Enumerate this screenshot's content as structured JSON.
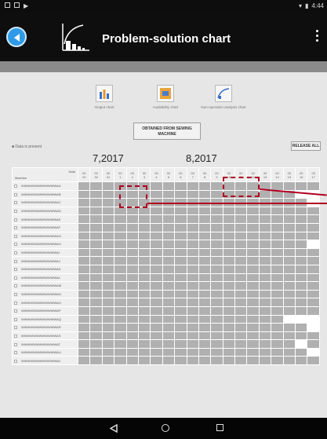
{
  "status_bar": {
    "time": "4:44"
  },
  "app_bar": {
    "title": "Problem-solution chart"
  },
  "chart_buttons": [
    {
      "label": "Output chart",
      "icon": "bar-chart-icon"
    },
    {
      "label": "Availability chart",
      "icon": "area-chart-icon"
    },
    {
      "label": "Non-operation analysis chart",
      "icon": "curve-chart-icon"
    }
  ],
  "obtained_button": "OBTAINED FROM SEWING MACHINE",
  "data_present_note": "■ Data is present",
  "release_all_button": "RELEASE ALL",
  "months": [
    "7,2017",
    "8,2017"
  ],
  "grid": {
    "header_date": "Date",
    "header_machine": "Machine",
    "days": [
      "29",
      "30",
      "31",
      "1",
      "2",
      "3",
      "4",
      "5",
      "6",
      "7",
      "8",
      "9",
      "10",
      "11",
      "12",
      "13",
      "14",
      "15",
      "16",
      "17"
    ],
    "day_prefix": "00",
    "machines": [
      "WWWWWWWWWWWWAA",
      "WWWWWWWWWWWWAB",
      "WWWWWWWWWWWWAC",
      "WWWWWWWWWWWWAD",
      "WWWWWWWWWWWWAE",
      "WWWWWWWWWWWWAF",
      "WWWWWWWWWWWWAG",
      "WWWWWWWWWWWWAH",
      "WWWWWWWWWWWWAI",
      "WWWWWWWWWWWWAJ",
      "WWWWWWWWWWWWAK",
      "WWWWWWWWWWWWAL",
      "WWWWWWWWWWWWAM",
      "WWWWWWWWWWWWAN",
      "WWWWWWWWWWWWAO",
      "WWWWWWWWWWWWAP",
      "WWWWWWWWWWWWAQ",
      "WWWWWWWWWWWWAR",
      "WWWWWWWWWWWWAS",
      "WWWWWWWWWWWWAT",
      "WWWWWWWWWWWWAU",
      "WWWWWWWWWWWWAV"
    ]
  },
  "colors": {
    "accent": "#2f9be8",
    "highlight": "#b00020",
    "cell_gray": "#b0b0b0"
  }
}
